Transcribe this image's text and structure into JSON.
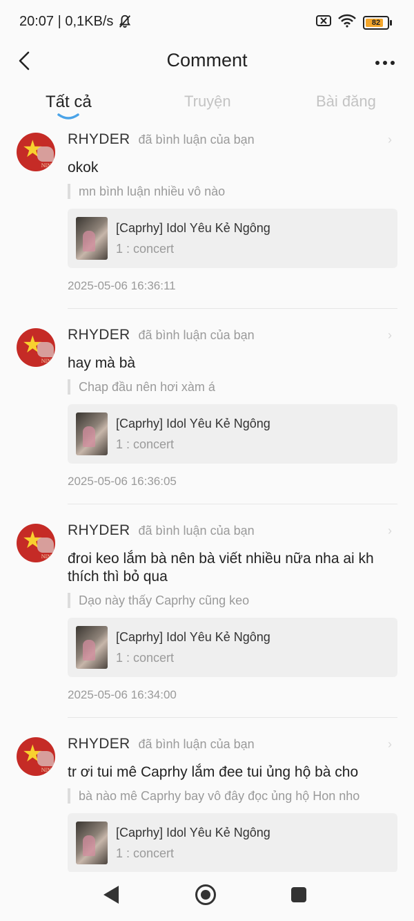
{
  "status_bar": {
    "time_speed": "20:07 | 0,1KB/s",
    "battery_level": "82",
    "battery_fraction": 0.82,
    "battery_color": "#f4a62a"
  },
  "header": {
    "title": "Comment"
  },
  "tabs": [
    {
      "label": "Tất cả",
      "active": true
    },
    {
      "label": "Truyện",
      "active": false
    },
    {
      "label": "Bài đăng",
      "active": false
    }
  ],
  "comments": [
    {
      "user": "RHYDER",
      "action": "đã bình luận của bạn",
      "text": "okok",
      "quote": "mn bình luận nhiều vô nào",
      "story_title": "[Caprhy] Idol Yêu Kẻ Ngông",
      "story_chapter": "1 : concert",
      "timestamp": "2025-05-06 16:36:11"
    },
    {
      "user": "RHYDER",
      "action": "đã bình luận của bạn",
      "text": "hay mà bà",
      "quote": "Chap đầu nên hơi xàm á",
      "story_title": "[Caprhy] Idol Yêu Kẻ Ngông",
      "story_chapter": "1 : concert",
      "timestamp": "2025-05-06 16:36:05"
    },
    {
      "user": "RHYDER",
      "action": "đã bình luận của bạn",
      "text": "đroi keo lắm bà nên bà viết nhiều nữa nha ai kh thích thì bỏ qua",
      "quote": "Dạo này thấy Caprhy cũng keo",
      "story_title": "[Caprhy] Idol Yêu Kẻ Ngông",
      "story_chapter": "1 : concert",
      "timestamp": "2025-05-06 16:34:00"
    },
    {
      "user": "RHYDER",
      "action": "đã bình luận của bạn",
      "text": "tr ơi tui mê Caprhy lắm đee tui ủng hộ bà cho",
      "quote": "bà nào mê Caprhy bay vô đây đọc ủng hộ Hon nho",
      "story_title": "[Caprhy] Idol Yêu Kẻ Ngông",
      "story_chapter": "1 : concert",
      "timestamp": ""
    }
  ],
  "avatar_text": "NIN"
}
